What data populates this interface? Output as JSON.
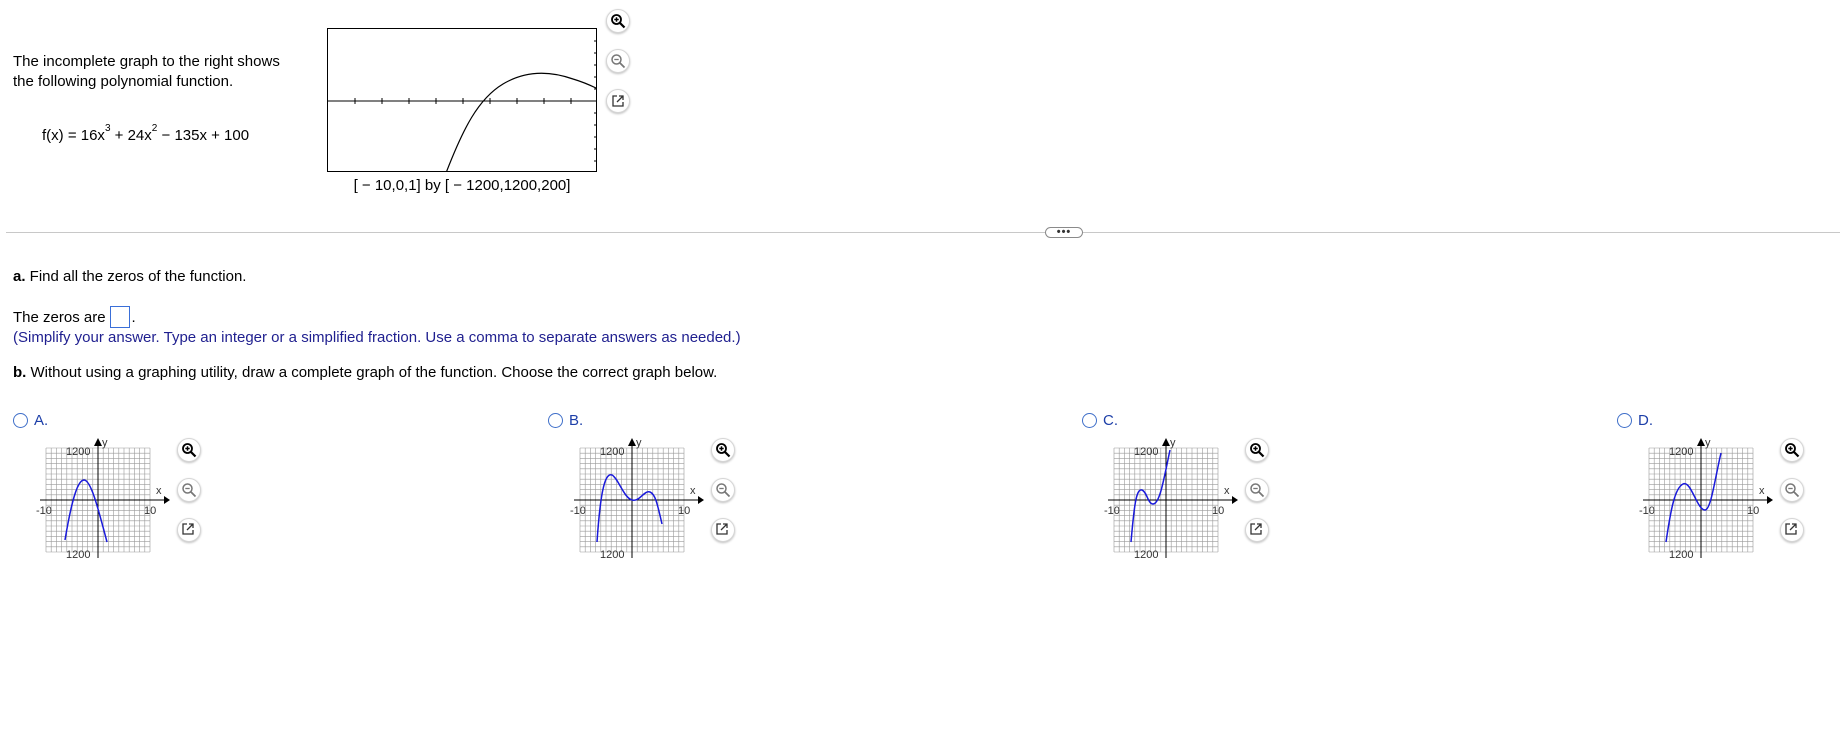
{
  "intro": {
    "line1": "The incomplete graph to the right shows",
    "line2": "the following polynomial function."
  },
  "function": {
    "prefix": "f(x) = 16x",
    "exp1": "3",
    "mid": " + 24x",
    "exp2": "2",
    "suffix": " − 135x + 100"
  },
  "main_graph": {
    "window_label": "[ − 10,0,1] by [ − 1200,1200,200]"
  },
  "tools": {
    "zoom_in": "zoom-in-icon",
    "zoom_out": "zoom-out-icon",
    "popout": "popout-icon"
  },
  "divider": {
    "handle": "•••"
  },
  "part_a": {
    "label": "a.",
    "text": " Find all the zeros of the function.",
    "zeros_prefix": "The zeros are",
    "zeros_suffix": ".",
    "hint": "(Simplify your answer. Type an integer or a simplified fraction. Use a comma to separate answers as needed.)"
  },
  "part_b": {
    "label": "b.",
    "text": " Without using a graphing utility, draw a complete graph of the function. Choose the correct graph below."
  },
  "choices": [
    {
      "letter": "A.",
      "y_top": "1200",
      "y_bot": "1200",
      "x_left": "-10",
      "x_right": "10",
      "x_axis": "x",
      "y_axis": "y"
    },
    {
      "letter": "B.",
      "y_top": "1200",
      "y_bot": "1200",
      "x_left": "-10",
      "x_right": "10",
      "x_axis": "x",
      "y_axis": "y"
    },
    {
      "letter": "C.",
      "y_top": "1200",
      "y_bot": "1200",
      "x_left": "-10",
      "x_right": "10",
      "x_axis": "x",
      "y_axis": "y"
    },
    {
      "letter": "D.",
      "y_top": "1200",
      "y_bot": "1200",
      "x_left": "-10",
      "x_right": "10",
      "x_axis": "x",
      "y_axis": "y"
    }
  ],
  "colors": {
    "curve_blue": "#1a1adb",
    "link_blue": "#1d3fa8",
    "hint_blue": "#1f1f8f"
  }
}
